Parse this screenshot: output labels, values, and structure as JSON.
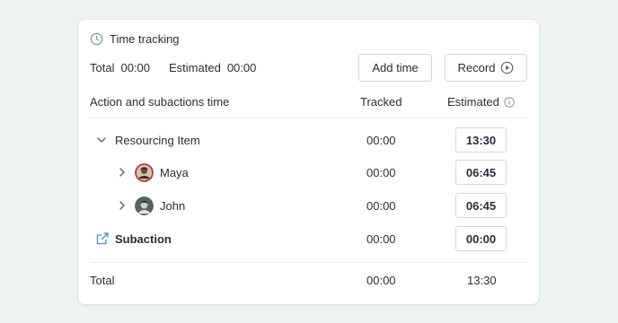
{
  "panel": {
    "title": "Time tracking",
    "summary": {
      "total_label": "Total",
      "total_value": "00:00",
      "estimated_label": "Estimated",
      "estimated_value": "00:00"
    },
    "buttons": {
      "add_time": "Add time",
      "record": "Record"
    }
  },
  "table": {
    "headers": {
      "action": "Action and subactions time",
      "tracked": "Tracked",
      "estimated": "Estimated"
    },
    "rows": [
      {
        "name": "Resourcing Item",
        "tracked": "00:00",
        "estimated": "13:30",
        "icon": "chevron-down-icon"
      },
      {
        "name": "Maya",
        "tracked": "00:00",
        "estimated": "06:45",
        "icon": "chevron-right-icon"
      },
      {
        "name": "John",
        "tracked": "00:00",
        "estimated": "06:45",
        "icon": "chevron-right-icon"
      },
      {
        "name": "Subaction",
        "tracked": "00:00",
        "estimated": "00:00",
        "icon": "external-link-icon"
      }
    ],
    "total": {
      "label": "Total",
      "tracked": "00:00",
      "estimated": "13:30"
    }
  },
  "colors": {
    "background": "#eef3f1",
    "accent": "#3a8fd6",
    "border": "#d3d6dc"
  }
}
